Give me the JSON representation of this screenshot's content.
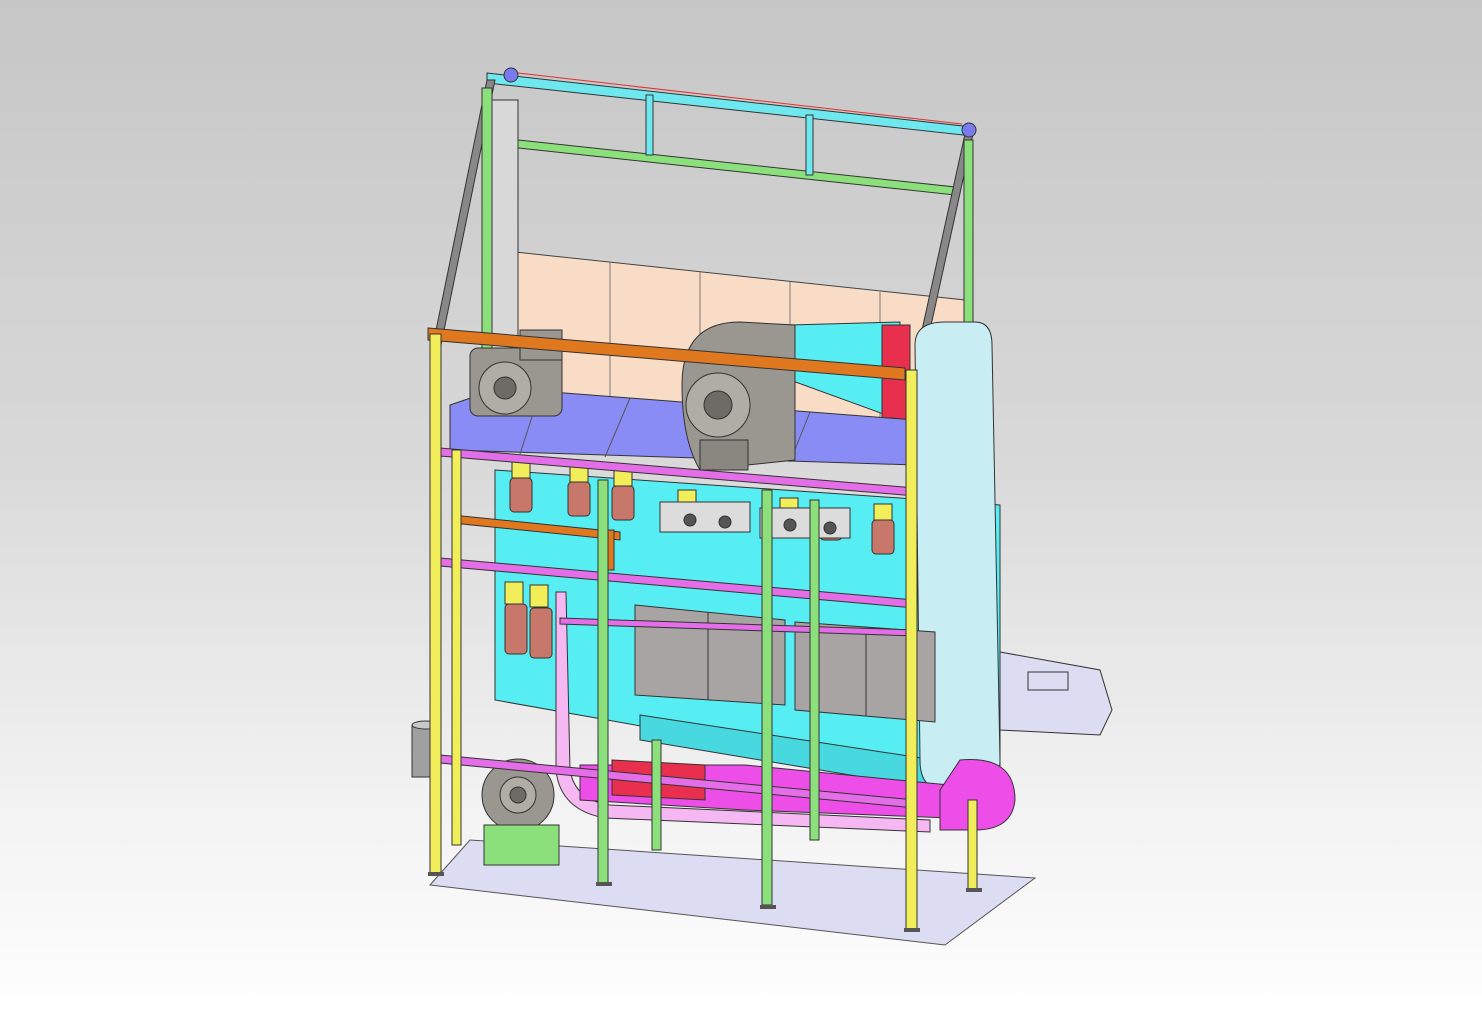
{
  "viewport": {
    "background_top": "#c6c6c6",
    "background_bottom": "#ffffff"
  },
  "model": {
    "colors": {
      "frame_yellow": "#f2ee5a",
      "frame_green": "#8ce07c",
      "frame_cyan": "#6ee8ee",
      "panel_blue": "#8a8cf6",
      "pink_beam": "#e46ee8",
      "orange_beam": "#e07820",
      "duct_cyan": "#56eef2",
      "back_panel": "#f8dcc6",
      "fan_gray": "#9a9690",
      "pipe_pink": "#f6b8f2",
      "duct_magenta": "#ee4ee8",
      "heater_red": "#e8304e",
      "base_plate": "#dcdcf2"
    }
  }
}
